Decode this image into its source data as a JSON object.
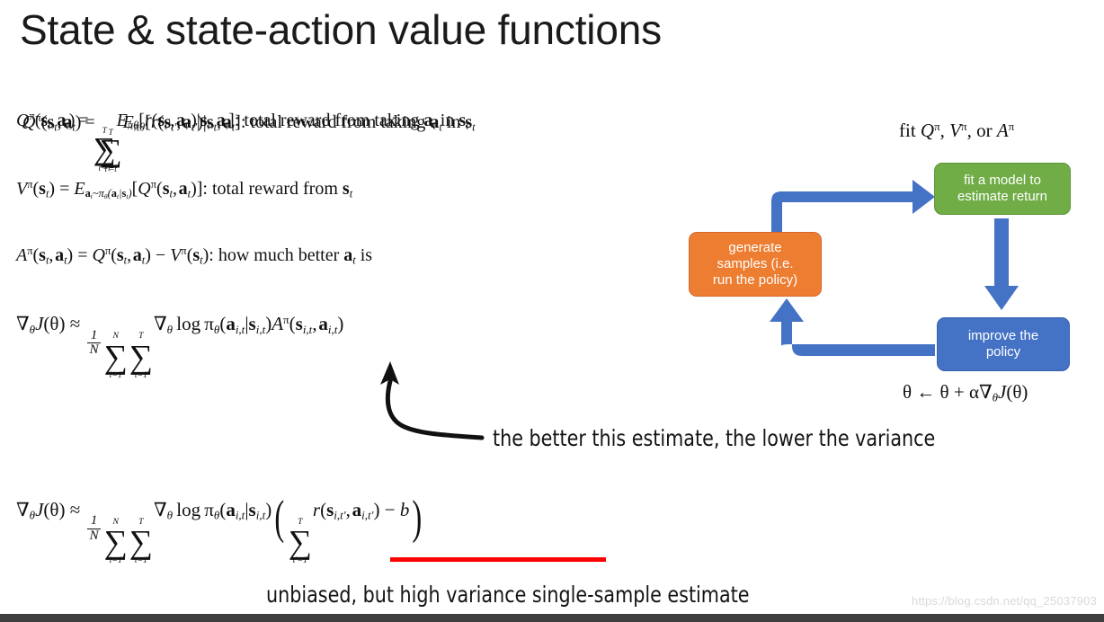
{
  "slide": {
    "title": "State & state-action value functions",
    "background_color": "#ffffff",
    "bottom_bar_color": "#3f3f3f"
  },
  "equations": {
    "q_definition": {
      "id": "eq-q",
      "note": "rendered twice with a small offset (double-exposure artifact in source slide)",
      "lhs": "Q^π(s_t, a_t) =",
      "sum_lower": "t'=t",
      "sum_upper": "T",
      "expectation": "E_{πθ}",
      "body": "[ r(s_t', a_t') | s_t, a_t ]",
      "caption": ": total reward from taking a_t in s_t",
      "plain": "Qπ(st,at) = Σ_{t'=t}^{T} Eπθ[r(st',at')|st,at]: total reward from taking at in st"
    },
    "v_definition": {
      "id": "eq-v",
      "plain": "Vπ(st) = E_{at~πθ(at|st)}[Qπ(st,at)]: total reward from st",
      "caption": ": total reward from s_t"
    },
    "a_definition": {
      "id": "eq-a",
      "plain": "Aπ(st,at) = Qπ(st,at) − Vπ(st): how much better at is",
      "caption": ": how much better a_t is"
    },
    "grad_advantage": {
      "id": "eq-grad-adv",
      "plain": "∇θJ(θ) ≈ (1/N) Σ_{i=1}^{N} Σ_{t=1}^{T} ∇θ log πθ(a_i,t|s_i,t) Aπ(s_i,t, a_i,t)",
      "frac_num": "1",
      "frac_den": "N",
      "sum1_lower": "i=1",
      "sum1_upper": "N",
      "sum2_lower": "t=1",
      "sum2_upper": "T"
    },
    "grad_reward_to_go": {
      "id": "eq-grad-baseline",
      "plain": "∇θJ(θ) ≈ (1/N) Σ_{i=1}^{N} Σ_{t=1}^{T} ∇θ log πθ(a_i,t|s_i,t) ( Σ_{t'=1}^{T} r(s_i,t', a_i,t') − b )",
      "inner_sum_lower": "t'=1",
      "inner_sum_upper": "T",
      "baseline_term": "− b",
      "underline_color": "#FF0000"
    }
  },
  "annotations": {
    "variance_note": "the better this estimate, the lower the variance",
    "unbiased_note": "unbiased, but high variance single-sample estimate"
  },
  "diagram": {
    "heading": "fit Qπ, Vπ, or Aπ",
    "heading_plain": "fit Q^π, V^π, or A^π",
    "update_rule": "θ ← θ + α∇θJ(θ)",
    "boxes": [
      {
        "id": "fit-model",
        "label": "fit a model to\nestimate return",
        "line1": "fit a model to",
        "line2": "estimate return",
        "color": "#70AD47"
      },
      {
        "id": "generate-samples",
        "label": "generate samples (i.e. run the policy)",
        "line1": "generate",
        "line2": "samples (i.e.",
        "line3": "run the policy)",
        "color": "#ED7D31"
      },
      {
        "id": "improve-policy",
        "label": "improve the policy",
        "line1": "improve the",
        "line2": "policy",
        "color": "#4472C4"
      }
    ],
    "arrow_color": "#4472C4",
    "arrows": [
      {
        "id": "samples-to-fit",
        "from": "generate-samples",
        "to": "fit-model",
        "shape": "elbow-up-right"
      },
      {
        "id": "fit-to-improve",
        "from": "fit-model",
        "to": "improve-policy",
        "shape": "straight-down"
      },
      {
        "id": "improve-to-samples",
        "from": "improve-policy",
        "to": "generate-samples",
        "shape": "elbow-left-up"
      }
    ]
  },
  "watermark": {
    "text": "https://blog.csdn.net/qq_25037903"
  }
}
